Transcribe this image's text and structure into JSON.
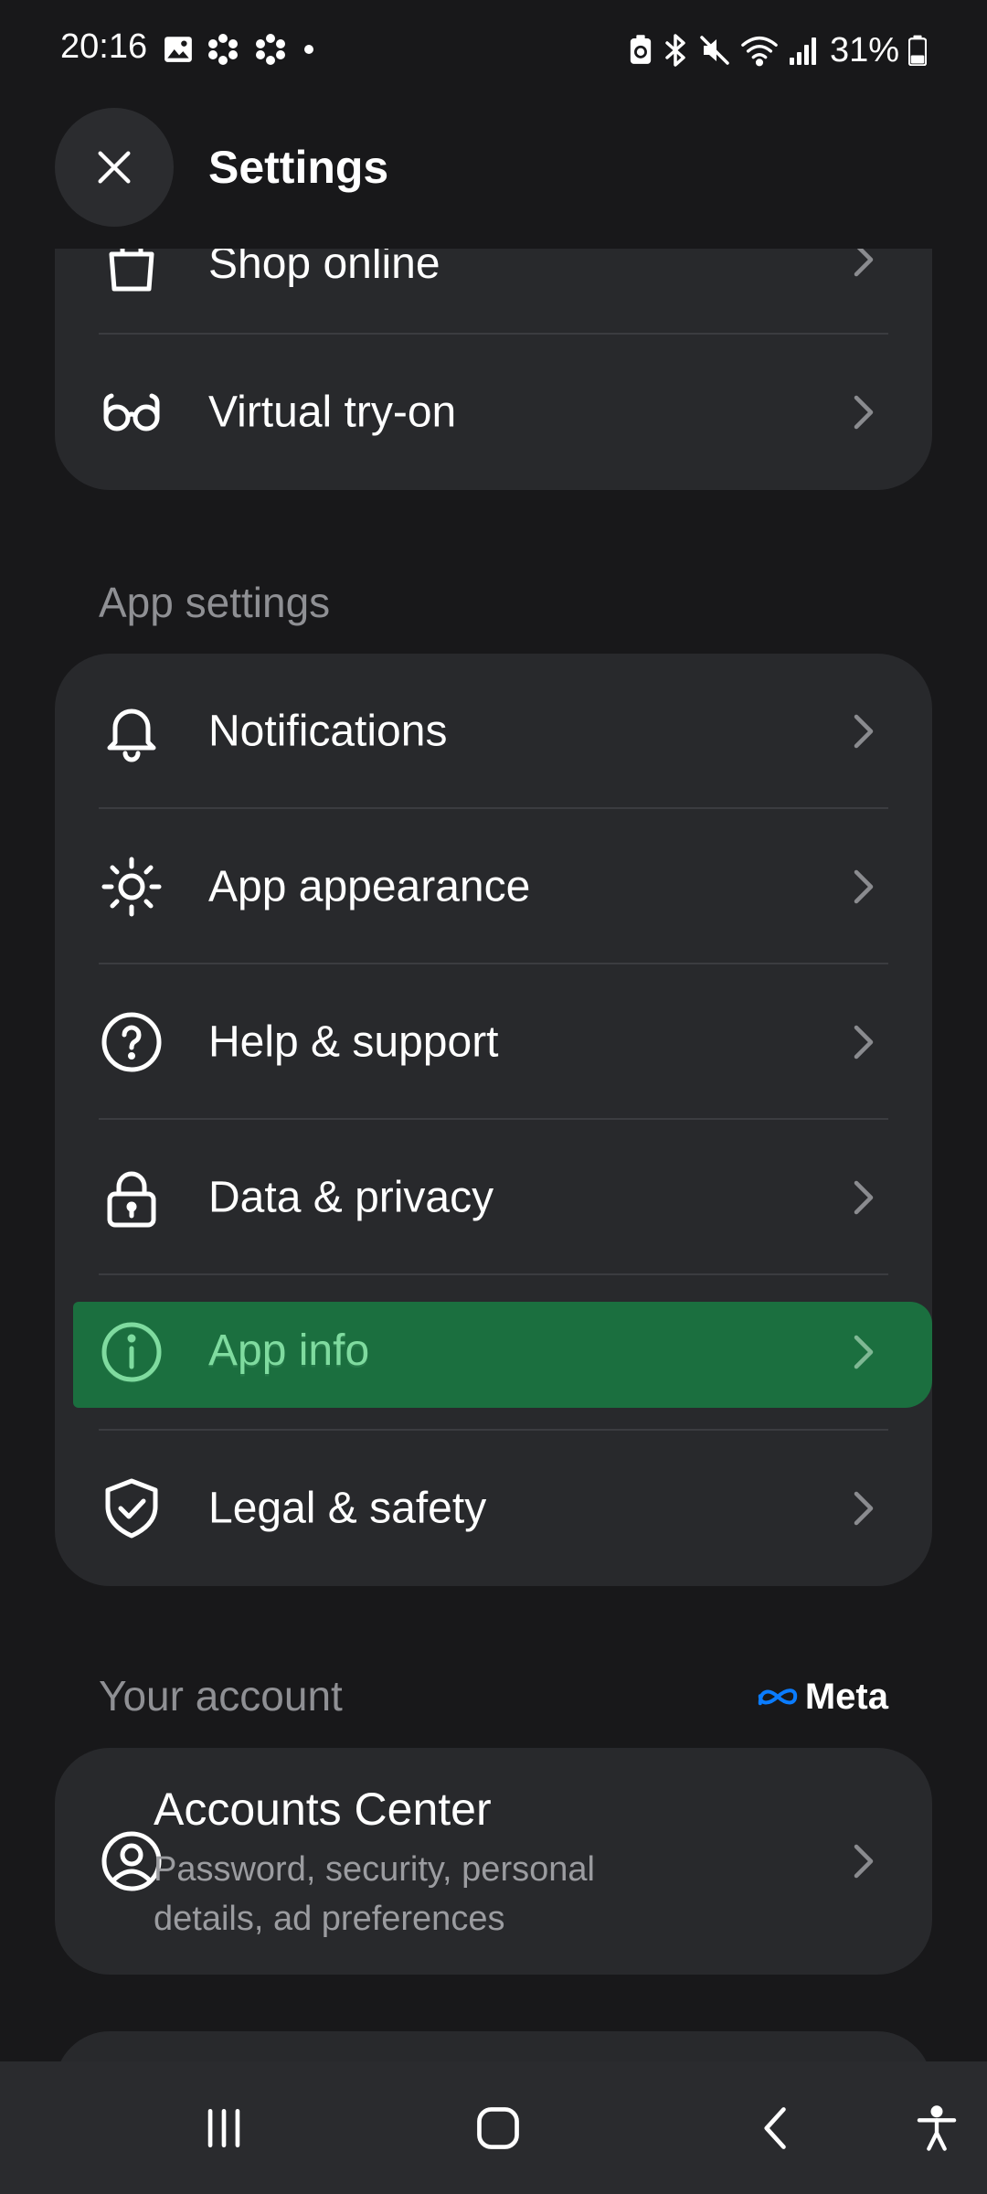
{
  "status_bar": {
    "time": "20:16",
    "battery": "31%"
  },
  "header": {
    "title": "Settings"
  },
  "shop_card": {
    "items": [
      {
        "label": "Shop online",
        "icon": "shopping-bag-icon"
      },
      {
        "label": "Virtual try-on",
        "icon": "glasses-icon"
      }
    ]
  },
  "app_settings": {
    "title": "App settings",
    "items": [
      {
        "label": "Notifications",
        "icon": "bell-icon"
      },
      {
        "label": "App appearance",
        "icon": "sun-icon"
      },
      {
        "label": "Help & support",
        "icon": "help-circle-icon"
      },
      {
        "label": "Data & privacy",
        "icon": "lock-icon"
      },
      {
        "label": "App info",
        "icon": "info-icon"
      },
      {
        "label": "Legal & safety",
        "icon": "shield-check-icon"
      }
    ]
  },
  "your_account": {
    "title": "Your account",
    "brand": "Meta",
    "accounts_center": {
      "title": "Accounts Center",
      "subtitle": "Password, security, personal details, ad preferences"
    }
  },
  "colors": {
    "background": "#18181a",
    "card": "#28292c",
    "highlight": "#1a7340",
    "highlight_text": "#7fdb9f",
    "secondary_text": "#8f9094",
    "meta_blue": "#0a7cff"
  }
}
